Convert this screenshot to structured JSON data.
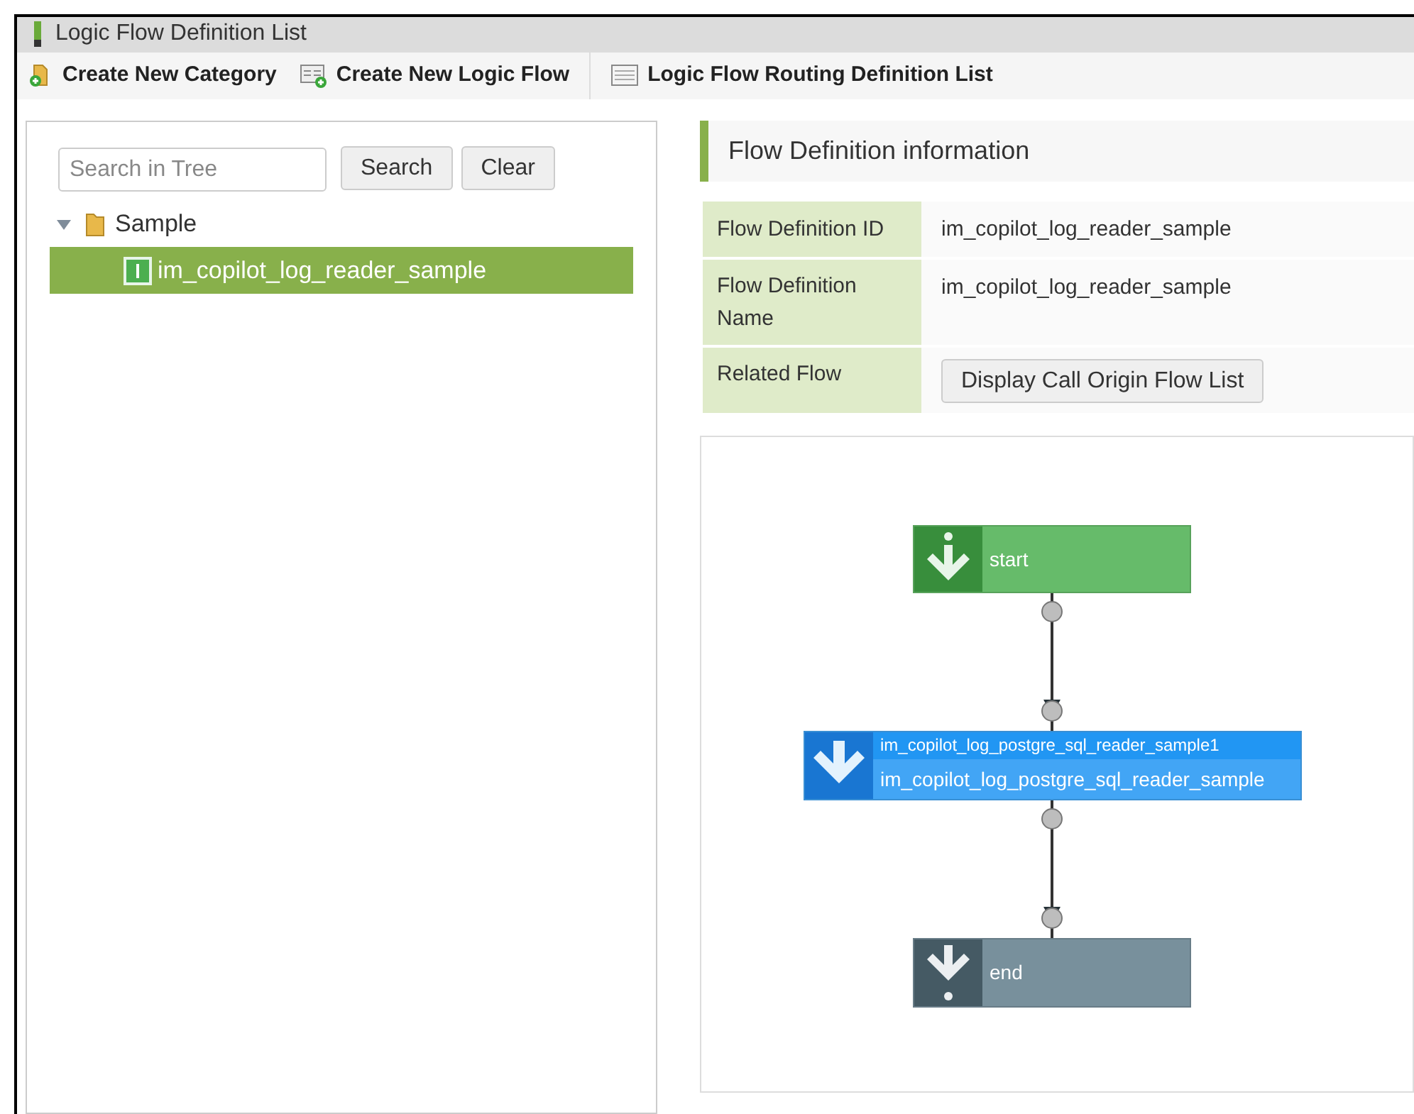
{
  "window": {
    "title": "Logic Flow Definition List"
  },
  "toolbar": [
    {
      "label": "Create New Category",
      "kind": "category"
    },
    {
      "label": "Create New Logic Flow",
      "kind": "flow"
    },
    {
      "label": "Logic Flow Routing Definition List",
      "kind": "list"
    }
  ],
  "search": {
    "placeholder": "Search in Tree",
    "buttons": [
      "Search",
      "Clear"
    ]
  },
  "tree": [
    {
      "label": "Sample",
      "expanded": true,
      "selected": false,
      "children": [
        {
          "label": "im_copilot_log_reader_sample",
          "selected": true
        }
      ]
    }
  ],
  "info": {
    "heading": "Flow Definition information",
    "rows": [
      {
        "label": "Flow Definition ID",
        "kind": "text",
        "value": "im_copilot_log_reader_sample"
      },
      {
        "label": "Flow Definition Name",
        "kind": "text",
        "value": "im_copilot_log_reader_sample"
      },
      {
        "label": "Related Flow",
        "kind": "button",
        "value": "Display Call Origin Flow List"
      }
    ]
  },
  "diagram": {
    "nodes": [
      {
        "kind": "start",
        "label": "start"
      },
      {
        "kind": "task",
        "label": "im_copilot_log_postgre_sql_reader_sample1",
        "sublabel": "im_copilot_log_postgre_sql_reader_sample"
      },
      {
        "kind": "end",
        "label": "end"
      }
    ]
  }
}
